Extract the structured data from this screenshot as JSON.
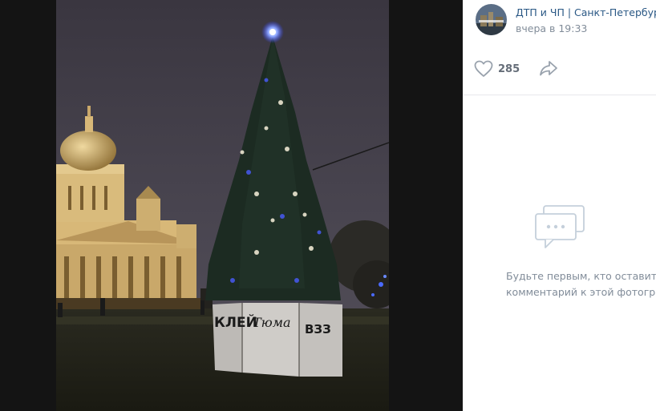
{
  "post": {
    "author": "ДТП и ЧП | Санкт-Петербург |",
    "time": "вчера в 19:33",
    "likes": "285"
  },
  "comments": {
    "empty_line1": "Будьте первым, кто оставит",
    "empty_line2": "комментарий к этой фотограф"
  },
  "graffiti": {
    "left": "КЛЕЙ",
    "middle": "Тюма",
    "right": "ВЗЗ"
  },
  "colors": {
    "link": "#2a5885",
    "muted": "#818c99",
    "divider": "#e7e8ec"
  }
}
